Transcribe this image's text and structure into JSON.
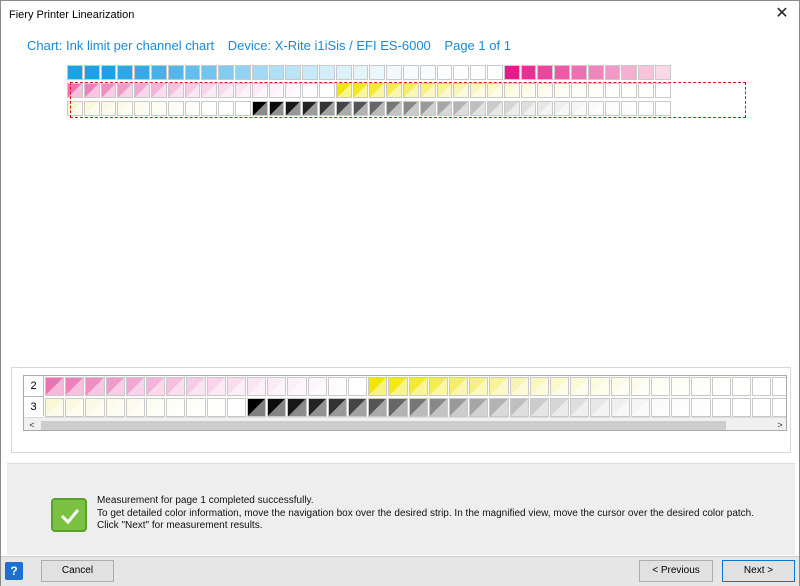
{
  "window": {
    "title": "Fiery Printer Linearization",
    "close_symbol": "✕"
  },
  "header": {
    "chart_label": "Chart: Ink limit per channel chart",
    "device_label": "Device: X-Rite i1iSis / EFI ES-6000",
    "page_label": "Page 1 of 1"
  },
  "magnified": {
    "row_labels": [
      "2",
      "3"
    ],
    "scroll_left": "<",
    "scroll_right": ">"
  },
  "status": {
    "line1": "Measurement for page 1 completed successfully.",
    "line2": "To get detailed color information, move the navigation box over the desired strip. In the magnified view, move the cursor over the desired color patch.",
    "line3": "Click \"Next\" for measurement results."
  },
  "footer": {
    "help_label": "?",
    "cancel_label": "Cancel",
    "previous_label": "< Previous",
    "next_label": "Next >"
  },
  "colors": {
    "cyan": "#1aa2e6",
    "magenta": "#e8198b",
    "yellow": "#f2e600",
    "black": "#000000",
    "accent": "#1a8ad4",
    "nav_box": "#d81b1b"
  },
  "strips": {
    "row1": [
      "#1aa2e6",
      "#1aa2e6",
      "#1aa2e6",
      "#2aa8e8",
      "#34abe8",
      "#44b1ea",
      "#52b7ec",
      "#62beee",
      "#72c5ef",
      "#82ccf1",
      "#92d3f3",
      "#a2d9f5",
      "#b0dff6",
      "#bce4f7",
      "#c8e9f8",
      "#d3edf9",
      "#dcf1fa",
      "#e4f4fb",
      "#ebf7fc",
      "#f1f9fd",
      "#f6fbfe",
      "#f9fcfe",
      "#fbfdfe",
      "#fdfefe",
      "#fefefe",
      "#ffffff",
      "#e8198b",
      "#ea2f95",
      "#ec449f",
      "#ee5aa9",
      "#f06fb3",
      "#f284bd",
      "#f499c7",
      "#f6aed1",
      "#f8c3db",
      "#fad8e5"
    ],
    "row2": [
      "#ec72b3",
      "#ee80bb",
      "#ef8ec3",
      "#f19bcb",
      "#f2a7d2",
      "#f4b3d9",
      "#f6bfdf",
      "#f7cae5",
      "#f9d4ea",
      "#fadcef",
      "#fbe4f3",
      "#fceaf6",
      "#fcf0f9",
      "#fdf5fb",
      "#fefafd",
      "#ffffff",
      "#f2e600",
      "#f3e81a",
      "#f4ea33",
      "#f5ec4d",
      "#f6ee66",
      "#f7f080",
      "#f8f299",
      "#f9f4b3",
      "#faf6bf",
      "#fbf8cc",
      "#fbf9d6",
      "#fcfadf",
      "#fcfbe6",
      "#fdfcec",
      "#fdfdf1",
      "#fefef5",
      "#fefef8",
      "#fefefb",
      "#fffffd",
      "#ffffff"
    ],
    "row3": [
      "#faf6d6",
      "#fbf8dd",
      "#fbf9e3",
      "#fcfae8",
      "#fcfbed",
      "#fdfcf1",
      "#fefdf5",
      "#fefef8",
      "#fefefb",
      "#fffffd",
      "#ffffff",
      "#000000",
      "#0c0c0c",
      "#181818",
      "#242424",
      "#333333",
      "#444444",
      "#555555",
      "#666666",
      "#777777",
      "#888888",
      "#999999",
      "#a6a6a6",
      "#b3b3b3",
      "#bfbfbf",
      "#cbcbcb",
      "#d6d6d6",
      "#dfdfdf",
      "#e8e8e8",
      "#efefef",
      "#f5f5f5",
      "#fafafa",
      "#fcfcfc",
      "#fdfdfd",
      "#fefefe",
      "#ffffff"
    ],
    "mag_row2": [
      "#ec72b3",
      "#ee80bb",
      "#ef8ec3",
      "#f19bcb",
      "#f2a7d2",
      "#f4b3d9",
      "#f6bfdf",
      "#f7cae5",
      "#f9d4ea",
      "#fadcef",
      "#fbe4f3",
      "#fceaf6",
      "#fcf0f9",
      "#fdf5fb",
      "#fefafd",
      "#ffffff",
      "#f2e600",
      "#f3e81a",
      "#f4ea33",
      "#f5ec4d",
      "#f6ee66",
      "#f7f080",
      "#f8f299",
      "#f9f4b3",
      "#faf6bf",
      "#fbf8cc",
      "#fbf9d6",
      "#fcfadf",
      "#fcfbe6",
      "#fdfcec",
      "#fdfdf1",
      "#fefef5",
      "#fefef8",
      "#fefefb",
      "#fffffd",
      "#ffffff",
      "#ffffff"
    ],
    "mag_row3": [
      "#faf6d6",
      "#fbf8dd",
      "#fbf9e3",
      "#fcfae8",
      "#fcfbed",
      "#fdfcf1",
      "#fefdf5",
      "#fefef8",
      "#fefefb",
      "#fffffd",
      "#000000",
      "#0c0c0c",
      "#181818",
      "#242424",
      "#333333",
      "#444444",
      "#555555",
      "#666666",
      "#777777",
      "#888888",
      "#999999",
      "#a6a6a6",
      "#b3b3b3",
      "#bfbfbf",
      "#cbcbcb",
      "#d6d6d6",
      "#dfdfdf",
      "#e8e8e8",
      "#efefef",
      "#f5f5f5",
      "#fafafa",
      "#fcfcfc",
      "#fdfdfd",
      "#fefefe",
      "#ffffff",
      "#ffffff",
      "#ffffff"
    ]
  }
}
